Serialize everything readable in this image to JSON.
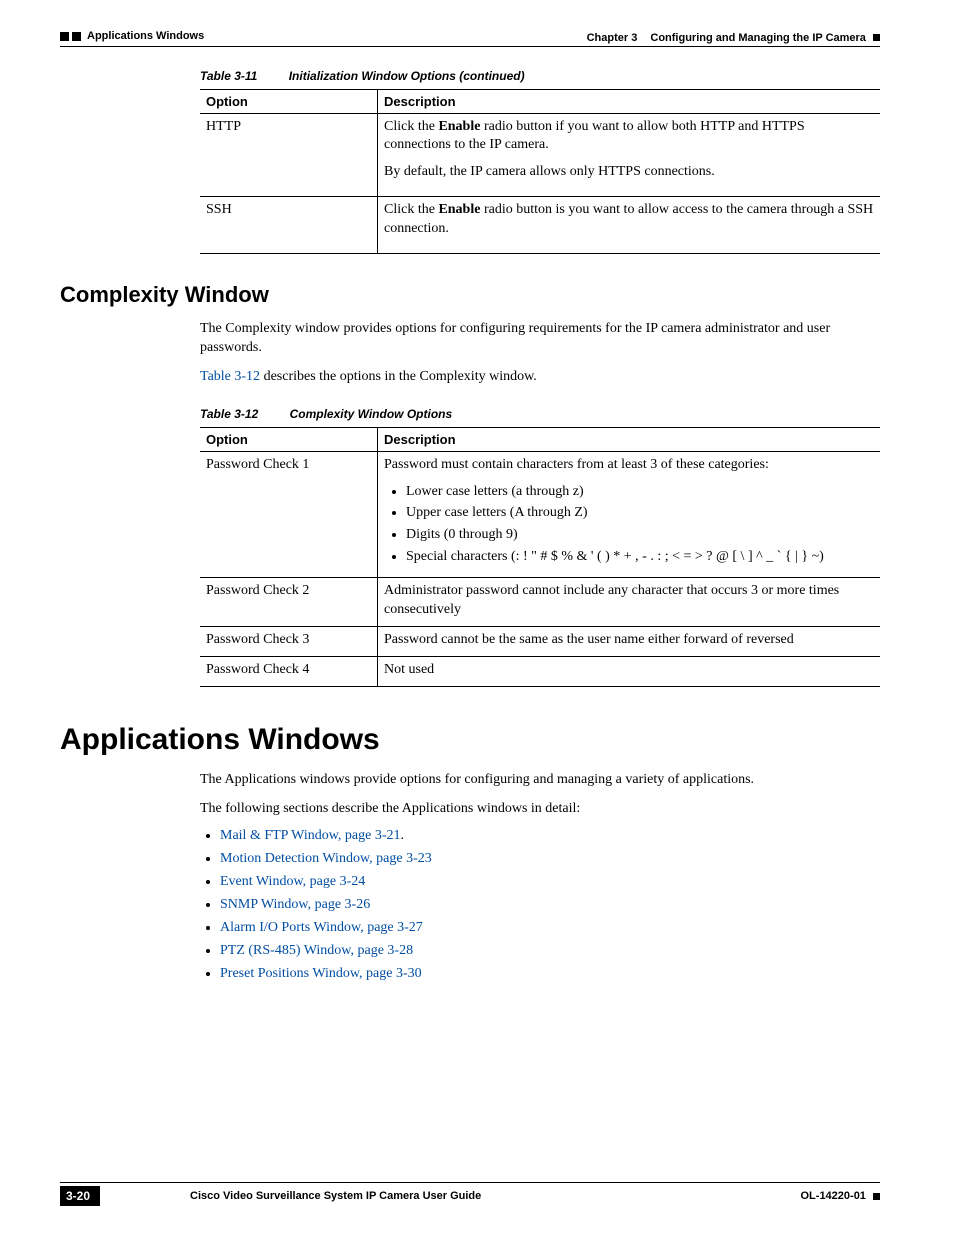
{
  "header": {
    "section": "Applications Windows",
    "chapter_ref": "Chapter 3",
    "chapter_title": "Configuring and Managing the IP Camera"
  },
  "table311": {
    "number": "Table 3-11",
    "title": "Initialization Window Options (continued)",
    "col1": "Option",
    "col2": "Description",
    "rows": [
      {
        "option": "HTTP",
        "desc_p1_pre": "Click the ",
        "desc_p1_bold": "Enable",
        "desc_p1_post": " radio button if you want to allow both HTTP and HTTPS connections to the IP camera.",
        "desc_p2": "By default, the IP camera allows only HTTPS connections."
      },
      {
        "option": "SSH",
        "desc_p1_pre": "Click the ",
        "desc_p1_bold": "Enable",
        "desc_p1_post": " radio button is you want to allow access to the camera through a SSH connection."
      }
    ]
  },
  "complexity": {
    "heading": "Complexity Window",
    "intro": "The Complexity window provides options for configuring requirements for the IP camera administrator and user passwords.",
    "ref_link": "Table 3-12",
    "ref_post": " describes the options in the Complexity window."
  },
  "table312": {
    "number": "Table 3-12",
    "title": "Complexity Window Options",
    "col1": "Option",
    "col2": "Description",
    "rows": [
      {
        "option": "Password Check 1",
        "lead": "Password must contain characters from at least 3 of these categories:",
        "bullets": [
          "Lower case letters (a through z)",
          "Upper case letters (A through Z)",
          "Digits (0 through 9)",
          "Special characters (: ! \" # $ % & ' ( ) * + , - . : ; < = > ? @ [ \\ ] ^ _ ` { | } ~)"
        ]
      },
      {
        "option": "Password Check 2",
        "desc": "Administrator password cannot include any character that occurs 3 or more times consecutively"
      },
      {
        "option": "Password Check 3",
        "desc": "Password cannot be the same as the user name either forward of reversed"
      },
      {
        "option": "Password Check 4",
        "desc": "Not used"
      }
    ]
  },
  "applications": {
    "heading": "Applications Windows",
    "p1": "The Applications windows provide options for configuring and managing a variety of applications.",
    "p2": "The following sections describe the Applications windows in detail:",
    "links": [
      {
        "text": "Mail & FTP Window, page 3-21",
        "suffix": "."
      },
      {
        "text": "Motion Detection Window, page 3-23",
        "suffix": ""
      },
      {
        "text": "Event Window, page 3-24",
        "suffix": ""
      },
      {
        "text": "SNMP Window, page 3-26",
        "suffix": ""
      },
      {
        "text": "Alarm I/O Ports Window, page 3-27",
        "suffix": ""
      },
      {
        "text": "PTZ (RS-485) Window, page 3-28",
        "suffix": ""
      },
      {
        "text": "Preset Positions Window, page 3-30",
        "suffix": ""
      }
    ]
  },
  "footer": {
    "guide": "Cisco Video Surveillance System IP Camera User Guide",
    "page": "3-20",
    "docnum": "OL-14220-01"
  }
}
